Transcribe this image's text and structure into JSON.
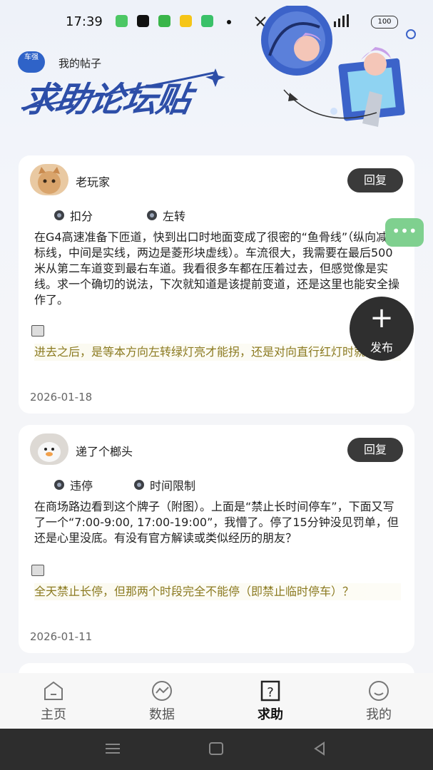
{
  "status": {
    "time": "17:39",
    "battery": "100"
  },
  "header": {
    "my_posts": "我的帖子",
    "brand": "求助论坛贴",
    "logo_text": "车强"
  },
  "posts": [
    {
      "username": "老玩家",
      "reply": "回复",
      "tags": [
        "扣分",
        "左转"
      ],
      "body": "在G4高速准备下匝道，快到出口时地面变成了很密的“鱼骨线”（纵向减速标线，中间是实线，两边是菱形块虚线）。车流很大，我需要在最后500米从第二车道变到最右车道。我看很多车都在压着过去，但感觉像是实线。求一个确切的说法，下次就知道是该提前变道，还是这里也能安全操作了。",
      "answer": "进去之后，是等本方向左转绿灯亮才能拐，还是对向直行红灯时就能拐？",
      "date": "2026-01-18"
    },
    {
      "username": "递了个榔头",
      "reply": "回复",
      "tags": [
        "违停",
        "时间限制"
      ],
      "body": "在商场路边看到这个牌子（附图）。上面是“禁止长时间停车”，下面又写了一个“7:00-9:00, 17:00-19:00”，我懵了。停了15分钟没见罚单，但还是心里没底。有没有官方解读或类似经历的朋友？",
      "answer": "全天禁止长停，但那两个时段完全不能停（即禁止临时停车）？",
      "date": "2026-01-11"
    }
  ],
  "fab": {
    "label": "发布",
    "plus": "+"
  },
  "float_more": "•••",
  "tabs": [
    {
      "label": "主页",
      "icon": "home-icon"
    },
    {
      "label": "数据",
      "icon": "chart-icon"
    },
    {
      "label": "求助",
      "icon": "question-icon"
    },
    {
      "label": "我的",
      "icon": "profile-icon"
    }
  ],
  "colors": {
    "brand_blue": "#2d4ea8",
    "answer_text": "#8b7a20",
    "float_green": "#7fd08f",
    "dark_button": "#3a3a3a"
  }
}
